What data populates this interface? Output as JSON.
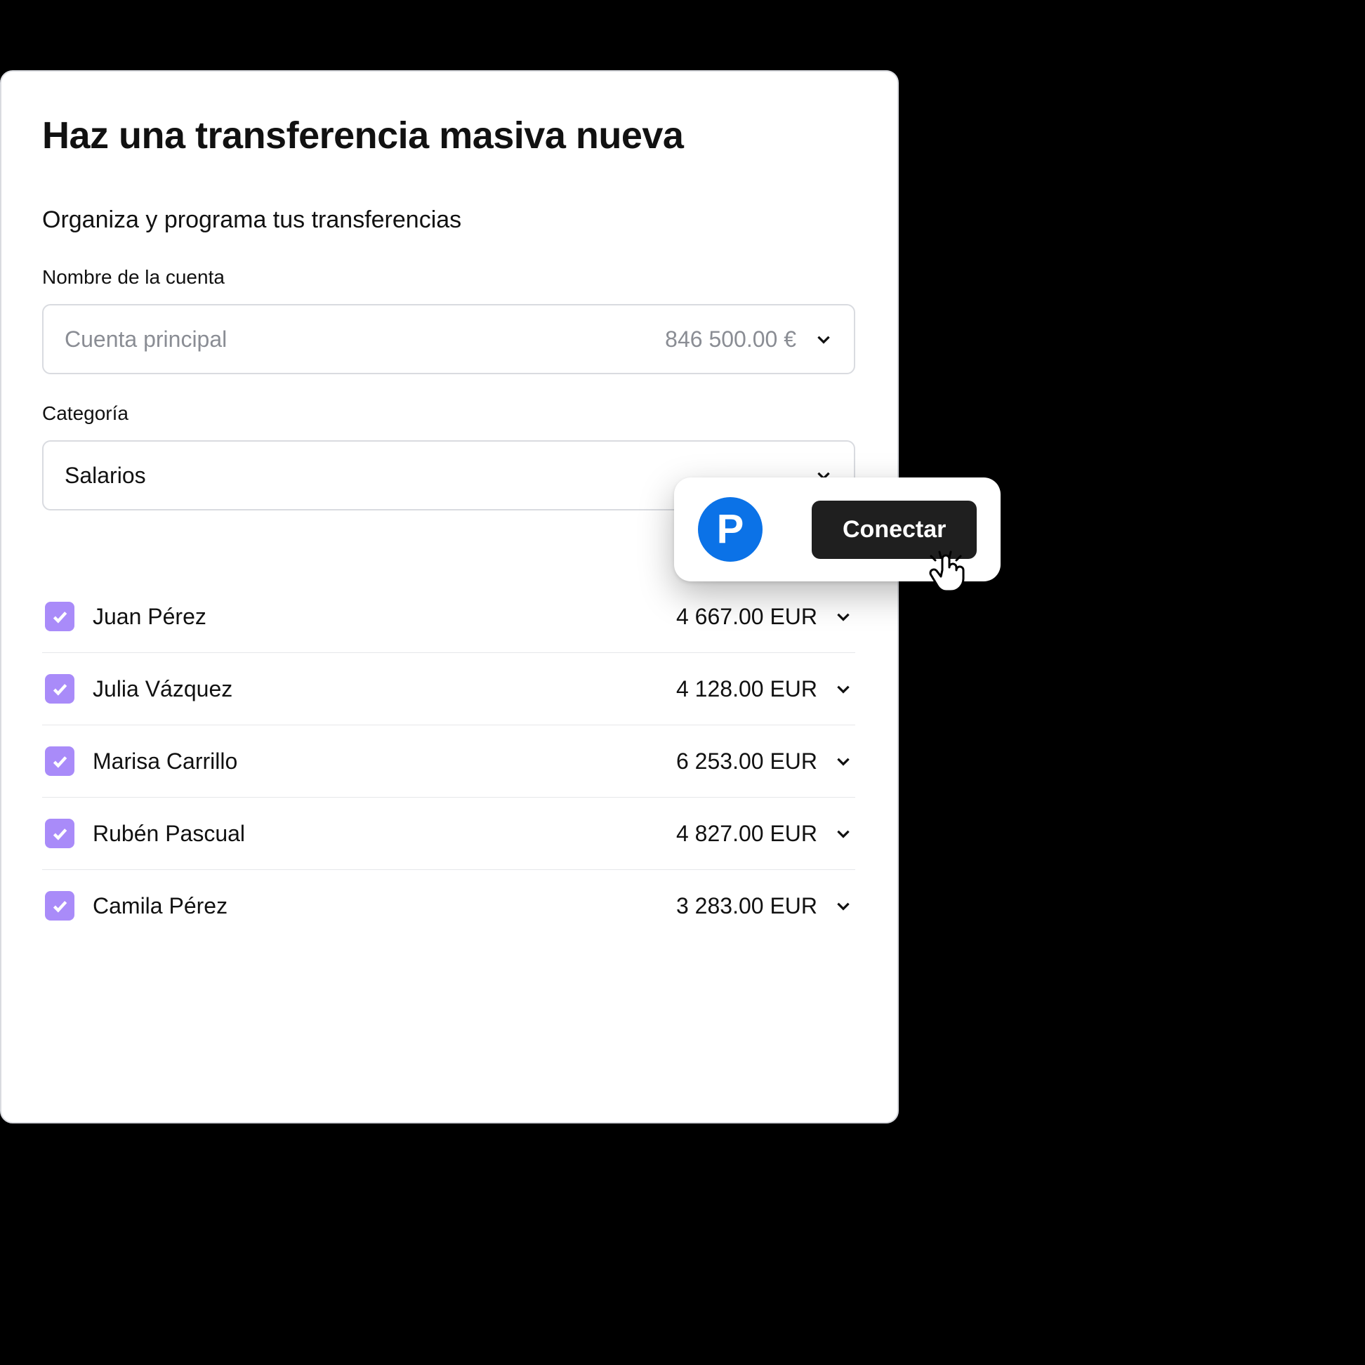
{
  "page": {
    "title": "Haz una transferencia masiva nueva",
    "subtitle": "Organiza y programa tus transferencias"
  },
  "account": {
    "label": "Nombre de la cuenta",
    "selected": "Cuenta principal",
    "balance": "846 500.00 €"
  },
  "category": {
    "label": "Categoría",
    "selected": "Salarios"
  },
  "transfers": [
    {
      "name": "Juan Pérez",
      "amount": "4 667.00 EUR"
    },
    {
      "name": "Julia Vázquez",
      "amount": "4 128.00 EUR"
    },
    {
      "name": "Marisa Carrillo",
      "amount": "6 253.00 EUR"
    },
    {
      "name": "Rubén Pascual",
      "amount": "4 827.00 EUR"
    },
    {
      "name": "Camila Pérez",
      "amount": "3 283.00 EUR"
    }
  ],
  "popover": {
    "brand_letter": "P",
    "connect_label": "Conectar"
  }
}
